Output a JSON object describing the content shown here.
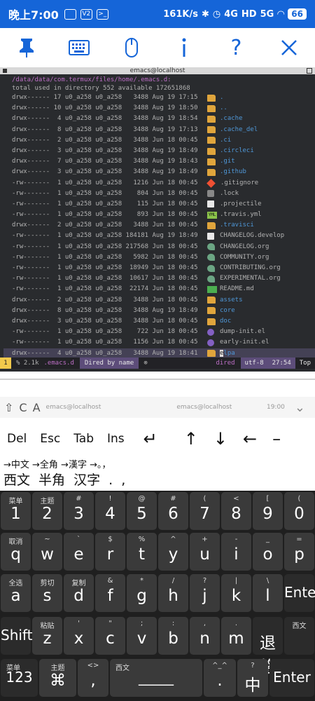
{
  "status": {
    "time": "晚上7:00",
    "speed": "161K/s",
    "network": "4G",
    "signal": "5G",
    "battery": "66",
    "v2": "V2",
    "hd": "HD"
  },
  "emacs": {
    "window_title": "emacs@localhost",
    "path": "/data/data/com.termux/files/home/.emacs.d:",
    "total": "total used in directory 552 available 172651868",
    "rows": [
      {
        "meta": "drwx------ 17 u0_a258 u0_a258   3488 Aug 19 17:15",
        "icon": "folder",
        "name": ".",
        "dir": true
      },
      {
        "meta": "drwx------ 10 u0_a258 u0_a258   3488 Aug 19 18:50",
        "icon": "folder",
        "name": "..",
        "dir": true
      },
      {
        "meta": "drwx------  4 u0_a258 u0_a258   3488 Aug 19 18:54",
        "icon": "folder",
        "name": ".cache",
        "dir": true
      },
      {
        "meta": "drwx------  8 u0_a258 u0_a258   3488 Aug 19 17:13",
        "icon": "folder",
        "name": ".cache_del",
        "dir": true
      },
      {
        "meta": "drwx------  2 u0_a258 u0_a258   3488 Jun 18 00:45",
        "icon": "folder",
        "name": ".ci",
        "dir": true
      },
      {
        "meta": "drwx------  3 u0_a258 u0_a258   3488 Aug 19 18:49",
        "icon": "folder",
        "name": ".circleci",
        "dir": true
      },
      {
        "meta": "drwx------  7 u0_a258 u0_a258   3488 Aug 19 18:43",
        "icon": "folder",
        "name": ".git",
        "dir": true
      },
      {
        "meta": "drwx------  3 u0_a258 u0_a258   3488 Aug 19 18:49",
        "icon": "folder",
        "name": ".github",
        "dir": true
      },
      {
        "meta": "-rw-------  1 u0_a258 u0_a258   1216 Jun 18 00:45",
        "icon": "git",
        "name": ".gitignore",
        "dir": false
      },
      {
        "meta": "-rw-------  1 u0_a258 u0_a258    804 Jun 18 00:45",
        "icon": "lock",
        "name": ".lock",
        "dir": false
      },
      {
        "meta": "-rw-------  1 u0_a258 u0_a258    115 Jun 18 00:45",
        "icon": "file",
        "name": ".projectile",
        "dir": false
      },
      {
        "meta": "-rw-------  1 u0_a258 u0_a258    893 Jun 18 00:45",
        "icon": "yml",
        "name": ".travis.yml",
        "dir": false
      },
      {
        "meta": "drwx------  2 u0_a258 u0_a258   3488 Jun 18 00:45",
        "icon": "folder",
        "name": ".travisci",
        "dir": true
      },
      {
        "meta": "-rw-------  1 u0_a258 u0_a258 184181 Aug 19 18:49",
        "icon": "file",
        "name": "CHANGELOG.develop",
        "dir": false
      },
      {
        "meta": "-rw-------  1 u0_a258 u0_a258 217568 Jun 18 00:45",
        "icon": "org",
        "name": "CHANGELOG.org",
        "dir": false
      },
      {
        "meta": "-rw-------  1 u0_a258 u0_a258   5982 Jun 18 00:45",
        "icon": "org",
        "name": "COMMUNITY.org",
        "dir": false
      },
      {
        "meta": "-rw-------  1 u0_a258 u0_a258  18949 Jun 18 00:45",
        "icon": "org",
        "name": "CONTRIBUTING.org",
        "dir": false
      },
      {
        "meta": "-rw-------  1 u0_a258 u0_a258  10617 Jun 18 00:45",
        "icon": "org",
        "name": "EXPERIMENTAL.org",
        "dir": false
      },
      {
        "meta": "-rw-------  1 u0_a258 u0_a258  22174 Jun 18 00:45",
        "icon": "md",
        "name": "README.md",
        "dir": false
      },
      {
        "meta": "drwx------  2 u0_a258 u0_a258   3488 Jun 18 00:45",
        "icon": "folder",
        "name": "assets",
        "dir": true
      },
      {
        "meta": "drwx------  8 u0_a258 u0_a258   3488 Aug 19 18:49",
        "icon": "folder",
        "name": "core",
        "dir": true
      },
      {
        "meta": "drwx------  3 u0_a258 u0_a258   3488 Jun 18 00:45",
        "icon": "folder",
        "name": "doc",
        "dir": true
      },
      {
        "meta": "-rw-------  1 u0_a258 u0_a258    722 Jun 18 00:45",
        "icon": "el",
        "name": "dump-init.el",
        "dir": false
      },
      {
        "meta": "-rw-------  1 u0_a258 u0_a258   1156 Jun 18 00:45",
        "icon": "el",
        "name": "early-init.el",
        "dir": false
      },
      {
        "meta": "drwx------  4 u0_a258 u0_a258   3488 Aug 19 18:41",
        "icon": "folder",
        "name": "elpa",
        "dir": true,
        "current": true
      }
    ],
    "modeline": {
      "window_num": "1",
      "size": "% 2.1k",
      "buffer": ".emacs.d",
      "mode_name": "Dired by name",
      "major": "dired",
      "encoding": "utf-8",
      "position": "27:54",
      "scroll": "Top"
    }
  },
  "ghostbar": {
    "left_text": "emacs@localhost",
    "mid_text": "emacs@localhost",
    "right_text": "19:00"
  },
  "extra_keys": [
    "Del",
    "Esc",
    "Tab",
    "Ins"
  ],
  "ime": {
    "hint": "→中文 →全角 →漢字 →。，",
    "candidates": "西文 半角 汉字 . ,"
  },
  "keyboard": {
    "row1": [
      {
        "sub": "菜单",
        "main": "1"
      },
      {
        "sub": "主题",
        "main": "2"
      },
      {
        "sub": "#",
        "main": "3"
      },
      {
        "sub": "!",
        "main": "4"
      },
      {
        "sub": "@",
        "main": "5"
      },
      {
        "sub": "#",
        "main": "6"
      },
      {
        "sub": "(",
        "main": "7"
      },
      {
        "sub": "<",
        "main": "8"
      },
      {
        "sub": "[",
        "main": "9"
      },
      {
        "sub": "(",
        "main": "0"
      }
    ],
    "row2": [
      {
        "sub": "取消",
        "main": "q"
      },
      {
        "sub": "~",
        "main": "w"
      },
      {
        "sub": "`",
        "main": "e"
      },
      {
        "sub": "$",
        "main": "r"
      },
      {
        "sub": "%",
        "main": "t"
      },
      {
        "sub": "^",
        "main": "y"
      },
      {
        "sub": "+",
        "main": "u"
      },
      {
        "sub": "-",
        "main": "i"
      },
      {
        "sub": "_",
        "main": "o"
      },
      {
        "sub": "=",
        "main": "p"
      }
    ],
    "row3": [
      {
        "sub": "全选",
        "main": "a"
      },
      {
        "sub": "剪切",
        "main": "s"
      },
      {
        "sub": "复制",
        "main": "d"
      },
      {
        "sub": "&",
        "main": "f"
      },
      {
        "sub": "*",
        "main": "g"
      },
      {
        "sub": "/",
        "main": "h"
      },
      {
        "sub": "?",
        "main": "j"
      },
      {
        "sub": "|",
        "main": "k"
      },
      {
        "sub": "\\",
        "main": "l"
      },
      {
        "sub": "",
        "main": "Enter"
      }
    ],
    "row4": [
      {
        "sub": "",
        "main": "Shift"
      },
      {
        "sub": "粘贴",
        "main": "z"
      },
      {
        "sub": "'",
        "main": "x"
      },
      {
        "sub": "\"",
        "main": "c"
      },
      {
        "sub": ";",
        "main": "v"
      },
      {
        "sub": ":",
        "main": "b"
      },
      {
        "sub": ",",
        "main": "n"
      },
      {
        "sub": ".",
        "main": "m"
      },
      {
        "sub": "",
        "main": "退格"
      },
      {
        "sub": "西文",
        "main": ""
      }
    ],
    "row5": [
      {
        "sub": "菜单",
        "main": "123"
      },
      {
        "sub": "主题",
        "main": "⌘"
      },
      {
        "sub": "<>",
        "main": ","
      },
      {
        "sub": "西文",
        "main": "_____"
      },
      {
        "sub": "^_^",
        "main": "."
      },
      {
        "sub": "?",
        "main": "中"
      },
      {
        "sub": "",
        "main": "Enter"
      }
    ]
  }
}
